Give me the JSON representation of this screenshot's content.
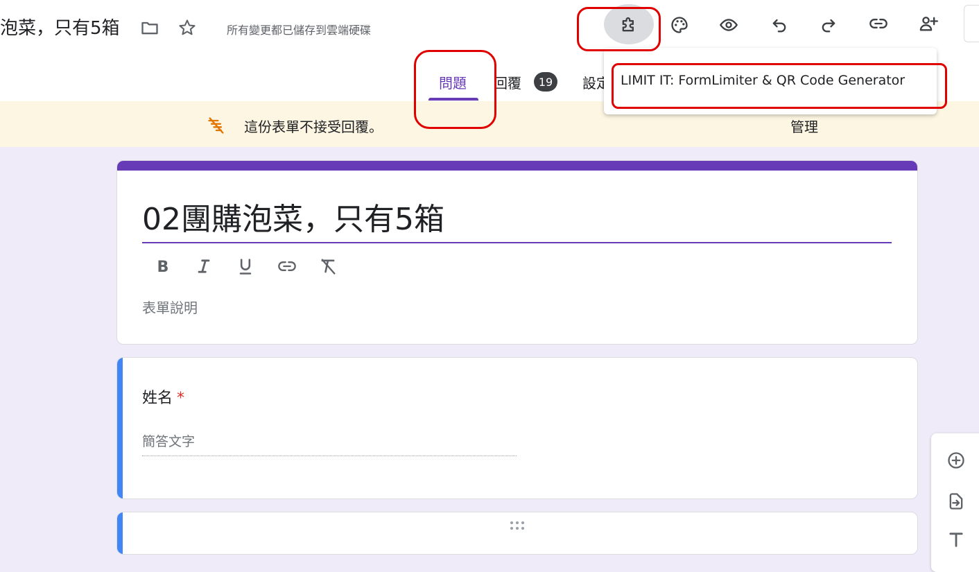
{
  "header": {
    "doc_title": "泡菜，只有5箱",
    "save_status": "所有變更都已儲存到雲端硬碟"
  },
  "toolbar_icons": [
    "folder-icon",
    "star-icon",
    "puzzle-icon",
    "palette-icon",
    "eye-icon",
    "undo-icon",
    "redo-icon",
    "link-icon",
    "add-person-icon"
  ],
  "tabs": [
    {
      "label": "問題",
      "active": true
    },
    {
      "label": "回覆",
      "badge": "19"
    },
    {
      "label": "設定"
    }
  ],
  "addons_menu": {
    "items": [
      "LIMIT IT: FormLimiter & QR Code Generator"
    ]
  },
  "banner": {
    "message": "這份表單不接受回覆。",
    "action": "管理"
  },
  "form": {
    "title": "02團購泡菜，只有5箱",
    "description_placeholder": "表單說明",
    "format_tools": [
      "bold-icon",
      "italic-icon",
      "underline-icon",
      "link-icon",
      "clear-format-icon"
    ]
  },
  "question": {
    "title": "姓名",
    "required_mark": "*",
    "answer_placeholder": "簡答文字"
  },
  "colors": {
    "accent": "#673ab7",
    "background": "#f0ebf8",
    "banner": "#fdf6e2",
    "question_accent": "#4285f4",
    "annotation": "#e00000"
  }
}
